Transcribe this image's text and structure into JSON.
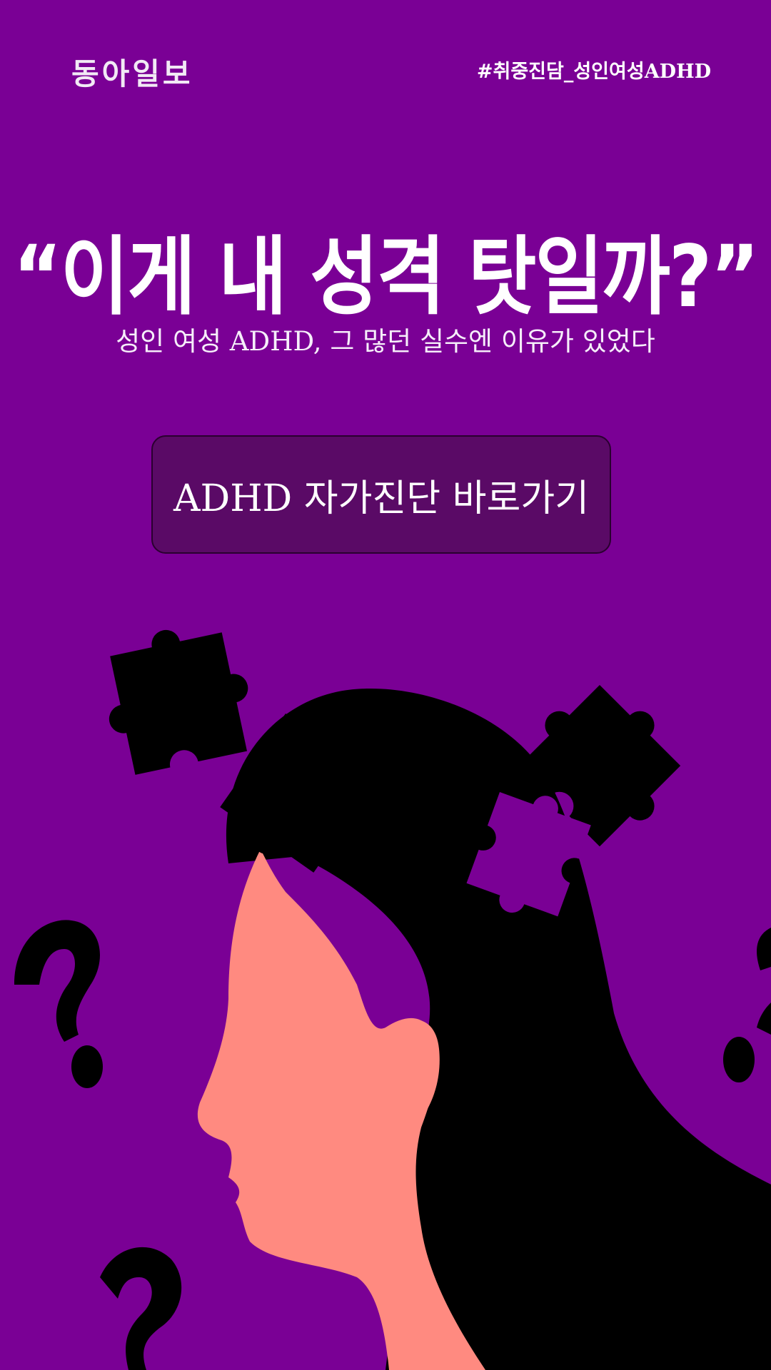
{
  "header": {
    "logo": "동아일보",
    "hashtag": "#취중진담_성인여성ADHD"
  },
  "hero": {
    "headline": "“이게 내 성격 탓일까?”",
    "subtitle": "성인 여성 ADHD, 그 많던 실수엔 이유가 있었다"
  },
  "cta": {
    "label": "ADHD 자가진단 바로가기"
  },
  "colors": {
    "background": "#7A0095",
    "button": "#5A0A66",
    "skin": "#FF8A80",
    "hair": "#000000"
  },
  "illustration": {
    "icons": [
      "puzzle-piece-icon",
      "question-mark-icon",
      "woman-head-silhouette"
    ]
  }
}
